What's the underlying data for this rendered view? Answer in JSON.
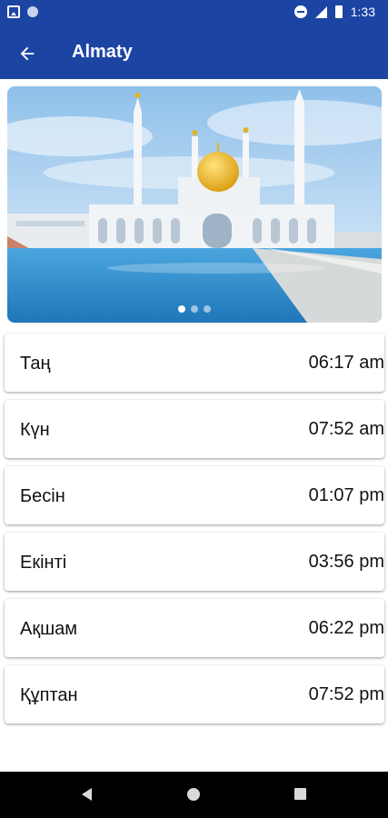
{
  "status_bar": {
    "time": "1:33"
  },
  "app_bar": {
    "title": "Almaty"
  },
  "carousel": {
    "page_count": 3,
    "active_index": 0
  },
  "prayer_times": [
    {
      "name": "Таң",
      "time": "06:17 am"
    },
    {
      "name": "Күн",
      "time": "07:52 am"
    },
    {
      "name": "Бесін",
      "time": "01:07 pm"
    },
    {
      "name": "Екінті",
      "time": "03:56 pm"
    },
    {
      "name": "Ақшам",
      "time": "06:22 pm"
    },
    {
      "name": "Құптан",
      "time": "07:52 pm"
    }
  ],
  "colors": {
    "primary": "#1c44a3",
    "gold_dome": "#e7b21d",
    "water": "#2f8fcf"
  }
}
